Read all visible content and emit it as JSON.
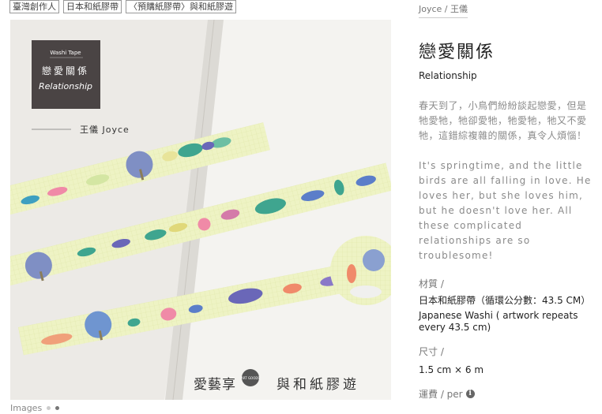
{
  "tags": [
    "臺灣創作人",
    "日本和紙膠帶",
    "〈預購紙膠帶〉與和紙膠遊"
  ],
  "image": {
    "badge_top": "Washi Tape",
    "badge_title_zh": "戀愛關係",
    "badge_title_en": "Relationship",
    "artist_caption": "王儀  Joyce",
    "brand_left": "愛藝享",
    "brand_logo": "ART GOODS",
    "brand_right": "與和紙膠遊",
    "images_label": "Images"
  },
  "product": {
    "artist_link": "Joyce / 王儀",
    "title_zh": "戀愛關係",
    "title_en": "Relationship",
    "desc_zh": "春天到了，小鳥們紛紛談起戀愛，但是牠愛牠，牠卻愛牠，牠愛牠，牠又不愛牠，這錯綜複雜的關係，真令人煩惱！",
    "desc_en": "It's springtime, and the little birds are all falling in love. He loves her, but she loves him, but he doesn't love her. All these complicated relationships are so troublesome!",
    "material_label": "材質 /",
    "material_zh": "日本和紙膠帶（循環公分數：43.5 CM）",
    "material_en": "Japanese Washi ( artwork repeats every 43.5 cm)",
    "size_label": "尺寸 /",
    "size_value": "1.5 cm × 6 m",
    "price_label": "運費 / per"
  },
  "colors": {
    "tape_bg": "#eef3c4",
    "board": "#3b2a22",
    "badge_bg": "#4a4444"
  }
}
